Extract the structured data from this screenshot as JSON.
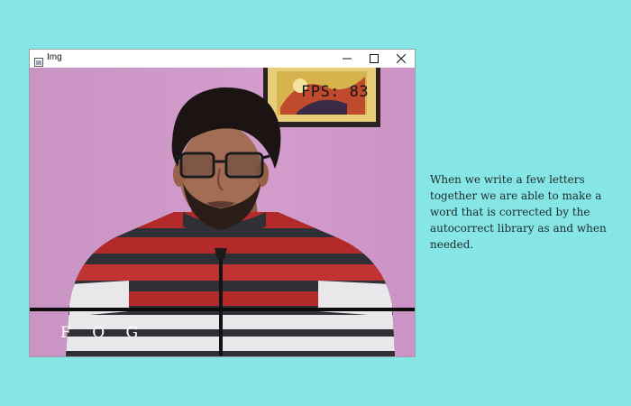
{
  "window": {
    "title": "Img",
    "controls": {
      "minimize": "minimize",
      "maximize": "maximize",
      "close": "close"
    }
  },
  "webcam": {
    "fps_text": "FPS: 83",
    "typed_text": "F O G"
  },
  "caption": {
    "text": "When we write a few letters together we are able to make a word that is corrected by the autocorrect library as and when needed."
  },
  "colors": {
    "background": "#86e6e6",
    "wall": "#cf98c8",
    "stripe_red": "#b42a2a",
    "stripe_dark": "#2f3036",
    "stripe_white": "#e8e8ea"
  }
}
